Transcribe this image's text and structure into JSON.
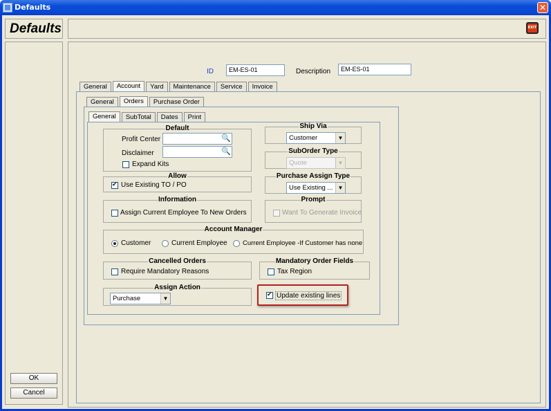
{
  "window": {
    "title": "Defaults",
    "close_glyph": "✕"
  },
  "header": {
    "title": "Defaults",
    "exit_label": "EXIT"
  },
  "left": {
    "ok_label": "OK",
    "cancel_label": "Cancel"
  },
  "form": {
    "id_label": "ID",
    "id_value": "EM-ES-01",
    "description_label": "Description",
    "description_value": "EM-ES-01"
  },
  "tabs1": [
    "General",
    "Account",
    "Yard",
    "Maintenance",
    "Service",
    "Invoice"
  ],
  "tabs2": [
    "General",
    "Orders",
    "Purchase Order"
  ],
  "tabs3": [
    "General",
    "SubTotal",
    "Dates",
    "Print"
  ],
  "default_group": {
    "title": "Default",
    "profit_center_label": "Profit Center",
    "profit_center_value": "",
    "disclaimer_label": "Disclaimer",
    "disclaimer_value": "",
    "expand_kits_label": "Expand Kits"
  },
  "ship_via": {
    "title": "Ship Via",
    "value": "Customer"
  },
  "suborder_type": {
    "title": "SubOrder Type",
    "value": "Quote"
  },
  "allow": {
    "title": "Allow",
    "use_existing_label": "Use Existing TO / PO"
  },
  "purchase_assign_type": {
    "title": "Purchase Assign Type",
    "value": "Use Existing ..."
  },
  "information": {
    "title": "Information",
    "assign_label": "Assign Current Employee To New Orders"
  },
  "prompt": {
    "title": "Prompt",
    "want_label": "Want To Generate Invoice"
  },
  "account_manager": {
    "title": "Account Manager",
    "opt_customer": "Customer",
    "opt_current": "Current Employee",
    "opt_current_if": "Current Employee -If Customer has none"
  },
  "cancelled_orders": {
    "title": "Cancelled Orders",
    "require_label": "Require Mandatory Reasons"
  },
  "mandatory_fields": {
    "title": "Mandatory Order Fields",
    "tax_region_label": "Tax Region"
  },
  "assign_action": {
    "title": "Assign Action",
    "value": "Purchase"
  },
  "update_lines": {
    "label": "Update existing lines"
  },
  "colors": {
    "title_bar": "#0a4bd8",
    "window_bg": "#ece9d8",
    "highlight": "#b32020",
    "id_label": "#1c3ecc"
  },
  "icons": [
    "search-icon",
    "exit-icon",
    "window-icon",
    "close-icon",
    "chevron-down-icon"
  ]
}
